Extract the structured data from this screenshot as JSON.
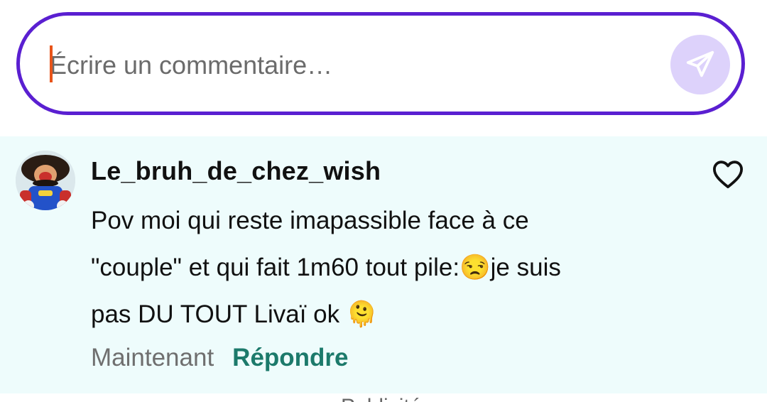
{
  "composer": {
    "placeholder": "Écrire un commentaire…",
    "send_icon": "paper-plane-icon",
    "accent_color": "#5a1fd1",
    "send_bg": "#ddd2fb"
  },
  "comment": {
    "username": "Le_bruh_de_chez_wish",
    "line1": "Pov moi qui reste imapassible face à ce",
    "line2_a": "\"couple\" et qui fait 1m60 tout pile:",
    "emoji1": "😒",
    "line2_b": "je suis",
    "line3_a": "pas DU TOUT Livaï ok ",
    "emoji2": "🫠",
    "time": "Maintenant",
    "reply_label": "Répondre",
    "like_icon": "heart-outline-icon",
    "background": "#eefcfc",
    "reply_color": "#1c7a6b"
  },
  "footer": {
    "peek_text": "Publicité"
  }
}
